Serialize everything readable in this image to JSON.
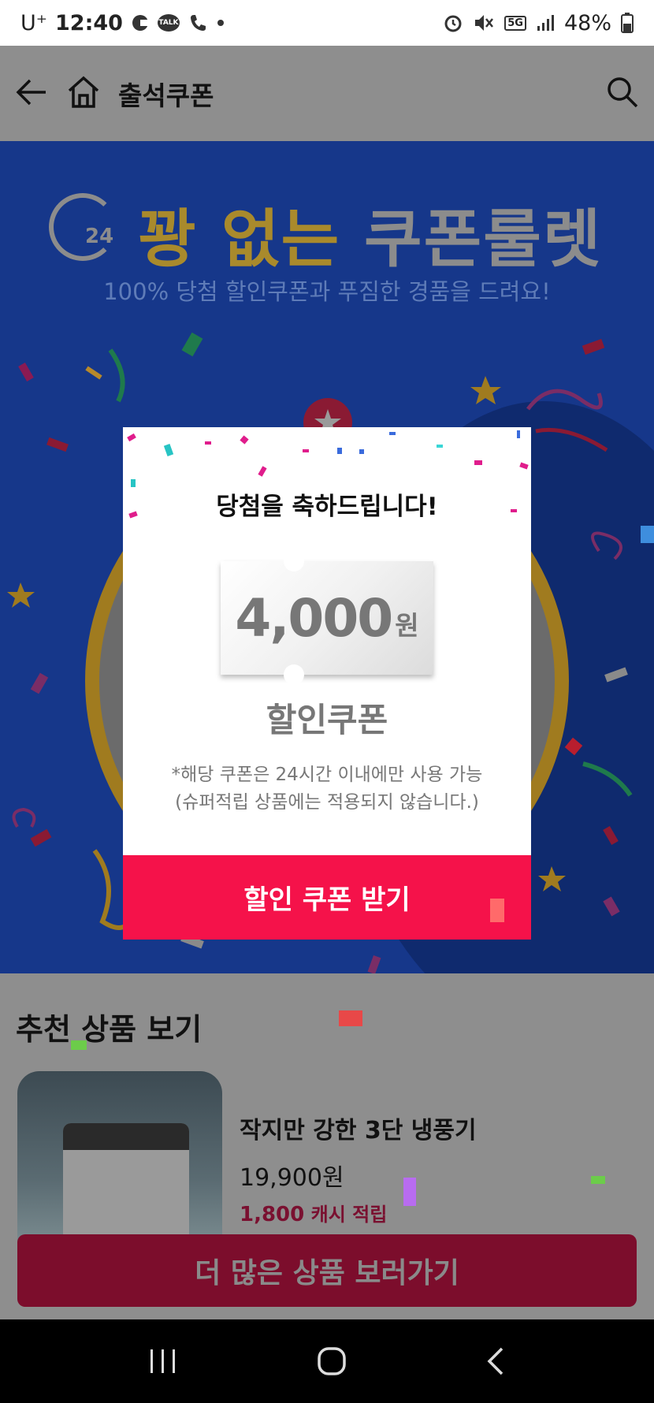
{
  "status_bar": {
    "carrier": "U⁺",
    "time": "12:40",
    "network": "5G",
    "battery": "48%"
  },
  "app_bar": {
    "title": "출석쿠폰"
  },
  "banner": {
    "title_gold": "꽝 없는",
    "title_grey": "쿠폰룰렛",
    "clock_number": "24",
    "subtitle": "100% 당첨 할인쿠폰과 푸짐한 경품을 드려요!"
  },
  "modal": {
    "heading": "당첨을 축하드립니다!",
    "coupon_amount": "4,000",
    "coupon_unit": "원",
    "coupon_type": "할인쿠폰",
    "note_line1": "*해당 쿠폰은 24시간 이내에만 사용 가능",
    "note_line2": "(슈퍼적립 상품에는 적용되지 않습니다.)",
    "claim_label": "할인 쿠폰 받기"
  },
  "recommend": {
    "heading": "추천 상품 보기",
    "product": {
      "name": "작지만 강한 3단 냉풍기",
      "price": "19,900원",
      "cash_amount": "1,800",
      "cash_label": "캐시 적립"
    },
    "more_label": "더 많은 상품 보러가기"
  },
  "colors": {
    "accent": "#f5124a",
    "banner_bg": "#16378a",
    "gold": "#a98a2c"
  }
}
